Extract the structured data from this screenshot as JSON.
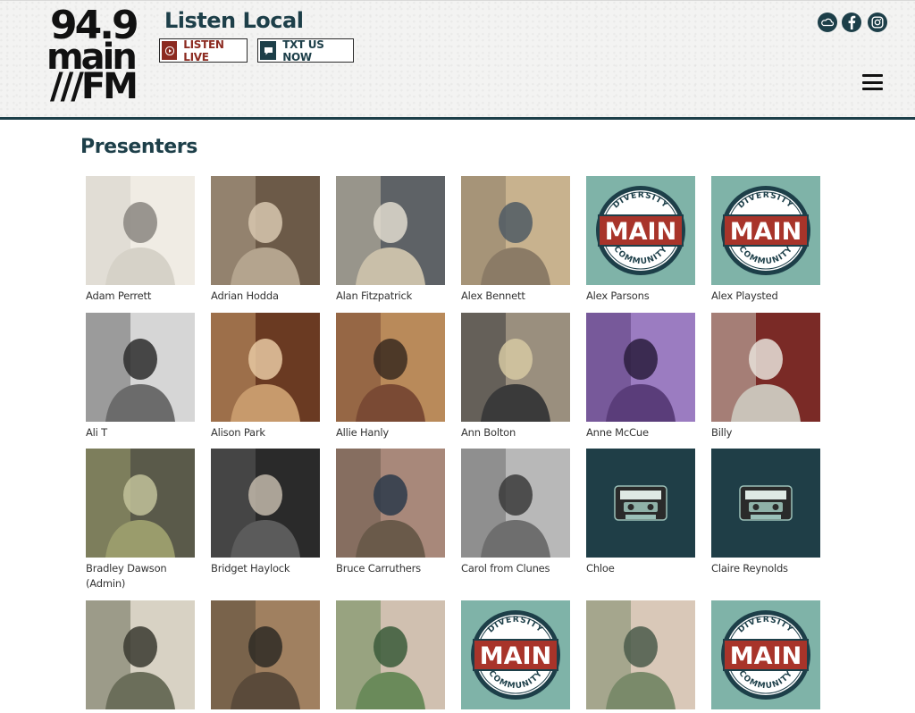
{
  "header": {
    "logo_line1": "94.9",
    "logo_line2": "main",
    "logo_line3": "///FM",
    "tagline": "Listen Local",
    "listen_live_label": "LISTEN LIVE",
    "txt_us_label": "TXT US NOW"
  },
  "social": {
    "soundcloud": "soundcloud-icon",
    "facebook": "facebook-icon",
    "instagram": "instagram-icon"
  },
  "colors": {
    "brand_dark": "#1d3f49",
    "brand_red": "#8c2a20",
    "main_badge_bg": "#7fb3a8",
    "cassette_bg": "#1f3e47"
  },
  "page": {
    "title": "Presenters"
  },
  "badge": {
    "top": "DIVERSITY",
    "middle": "MAIN",
    "bottom": "COMMUNITY"
  },
  "presenters": [
    {
      "name": "Adam Perrett",
      "type": "photo"
    },
    {
      "name": "Adrian Hodda",
      "type": "photo"
    },
    {
      "name": "Alan Fitzpatrick",
      "type": "photo"
    },
    {
      "name": "Alex Bennett",
      "type": "photo"
    },
    {
      "name": "Alex Parsons",
      "type": "badge"
    },
    {
      "name": "Alex Playsted",
      "type": "badge"
    },
    {
      "name": "Ali T",
      "type": "photo"
    },
    {
      "name": "Alison Park",
      "type": "photo"
    },
    {
      "name": "Allie Hanly",
      "type": "photo"
    },
    {
      "name": "Ann Bolton",
      "type": "photo"
    },
    {
      "name": "Anne McCue",
      "type": "photo"
    },
    {
      "name": "Billy",
      "type": "photo"
    },
    {
      "name": "Bradley Dawson (Admin)",
      "type": "photo"
    },
    {
      "name": "Bridget Haylock",
      "type": "photo"
    },
    {
      "name": "Bruce Carruthers",
      "type": "photo"
    },
    {
      "name": "Carol from Clunes",
      "type": "photo"
    },
    {
      "name": "Chloe",
      "type": "cassette"
    },
    {
      "name": "Claire Reynolds",
      "type": "cassette"
    },
    {
      "name": "",
      "type": "photo"
    },
    {
      "name": "",
      "type": "photo"
    },
    {
      "name": "",
      "type": "photo"
    },
    {
      "name": "",
      "type": "badge"
    },
    {
      "name": "",
      "type": "photo"
    },
    {
      "name": "",
      "type": "badge"
    }
  ]
}
